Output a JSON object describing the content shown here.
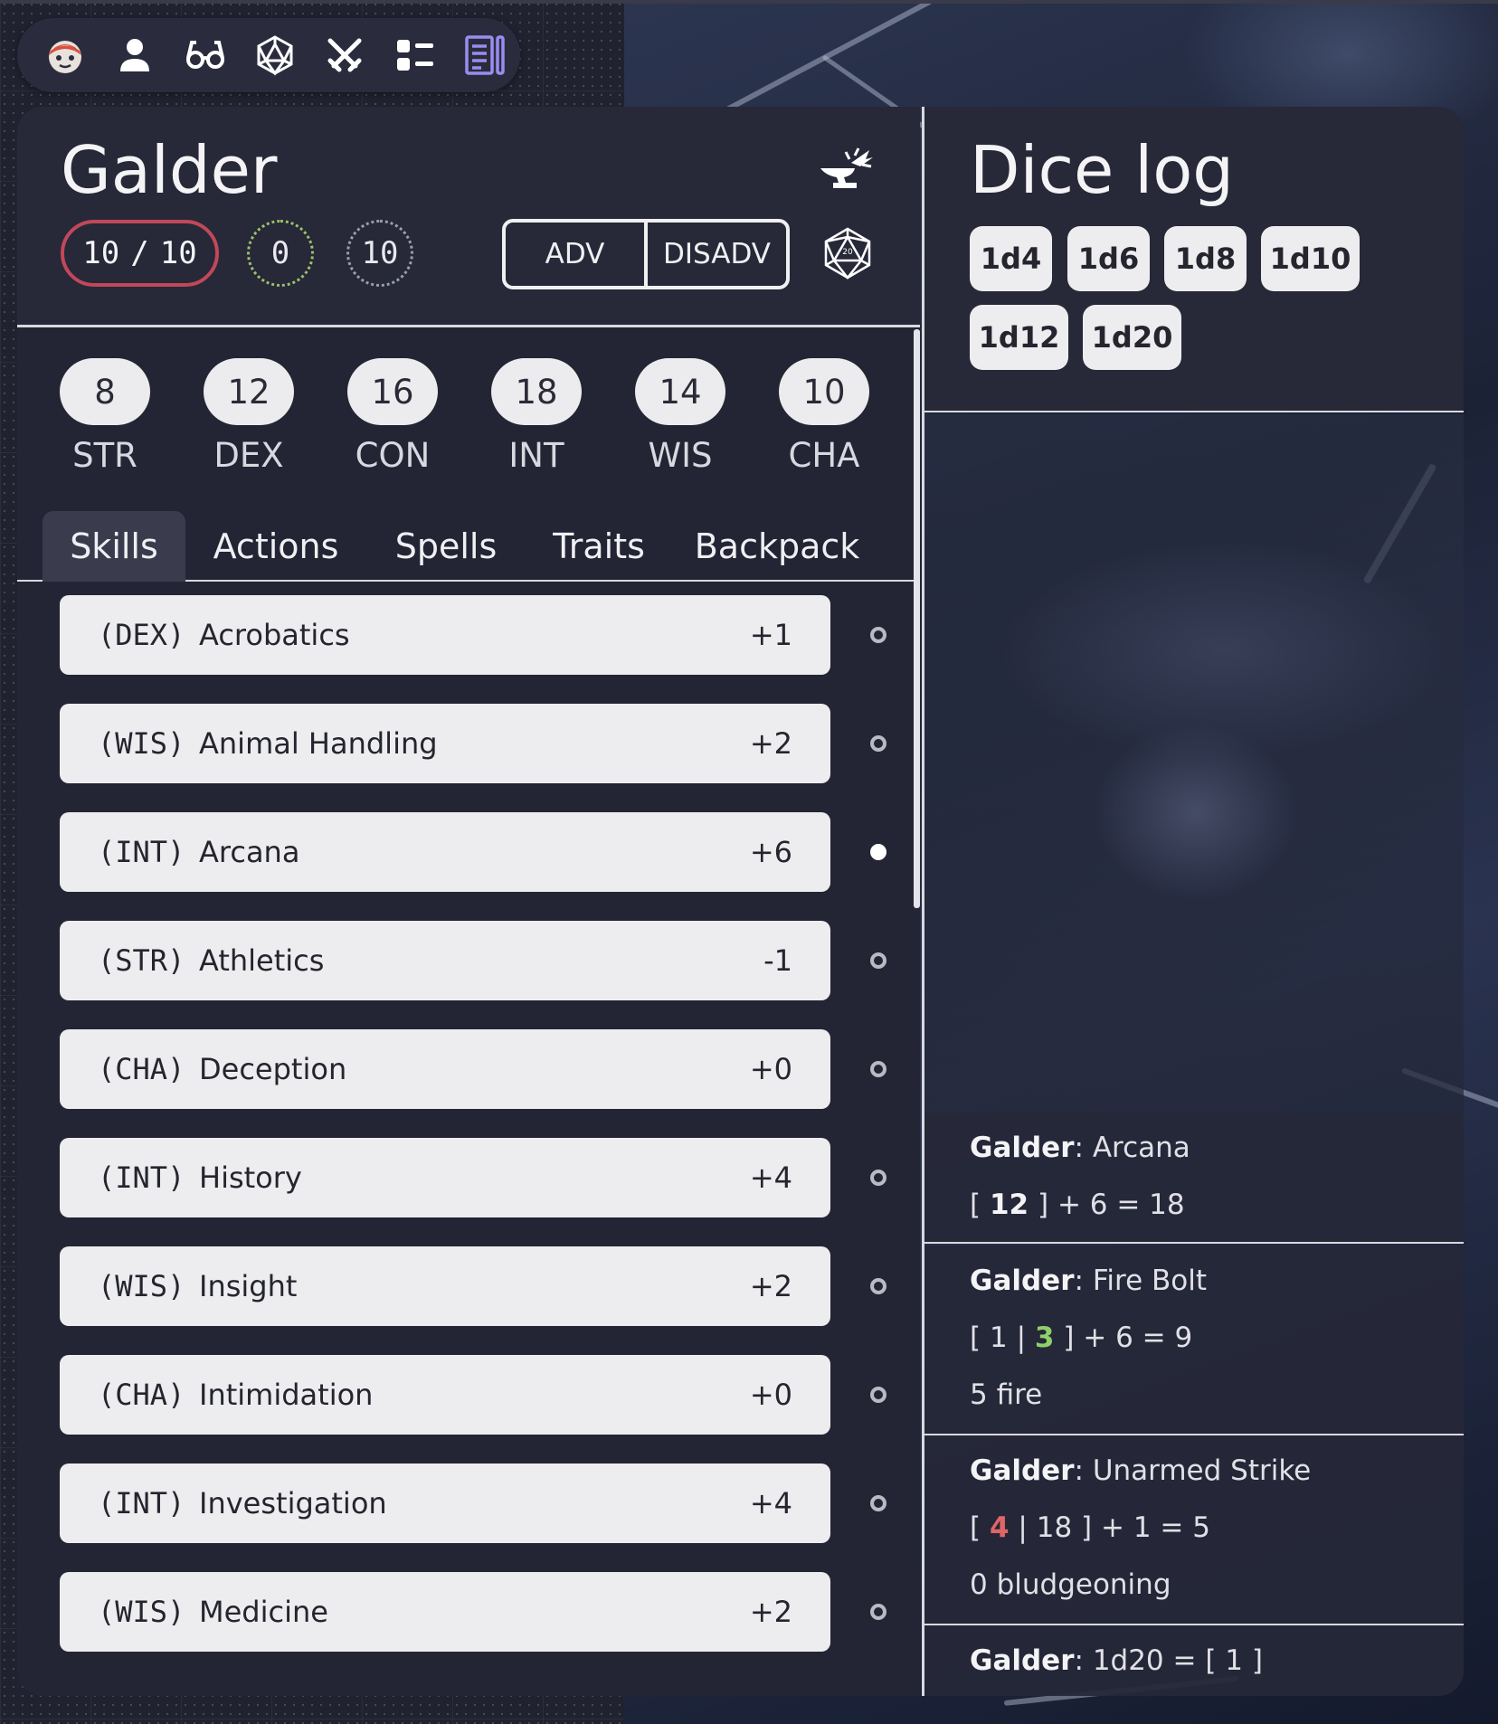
{
  "toolbar": {
    "items": [
      {
        "name": "app-logo-icon"
      },
      {
        "name": "character-icon"
      },
      {
        "name": "glasses-icon"
      },
      {
        "name": "dice-icon"
      },
      {
        "name": "crossed-swords-icon"
      },
      {
        "name": "list-icon"
      },
      {
        "name": "notes-icon",
        "active": true
      }
    ],
    "active_color": "#9b8cf0"
  },
  "character": {
    "name": "Galder",
    "hp_current": "10",
    "hp_sep": "/",
    "hp_max": "10",
    "temp_hp": "0",
    "ac": "10",
    "adv_label": "ADV",
    "disadv_label": "DISADV"
  },
  "abilities": [
    {
      "value": "8",
      "label": "STR"
    },
    {
      "value": "12",
      "label": "DEX"
    },
    {
      "value": "16",
      "label": "CON"
    },
    {
      "value": "18",
      "label": "INT"
    },
    {
      "value": "14",
      "label": "WIS"
    },
    {
      "value": "10",
      "label": "CHA"
    }
  ],
  "tabs": [
    "Skills",
    "Actions",
    "Spells",
    "Traits",
    "Backpack"
  ],
  "active_tab": "Skills",
  "skills": [
    {
      "ability": "(DEX)",
      "name": "Acrobatics",
      "mod": "+1",
      "proficient": false
    },
    {
      "ability": "(WIS)",
      "name": "Animal Handling",
      "mod": "+2",
      "proficient": false
    },
    {
      "ability": "(INT)",
      "name": "Arcana",
      "mod": "+6",
      "proficient": true
    },
    {
      "ability": "(STR)",
      "name": "Athletics",
      "mod": "-1",
      "proficient": false
    },
    {
      "ability": "(CHA)",
      "name": "Deception",
      "mod": "+0",
      "proficient": false
    },
    {
      "ability": "(INT)",
      "name": "History",
      "mod": "+4",
      "proficient": false
    },
    {
      "ability": "(WIS)",
      "name": "Insight",
      "mod": "+2",
      "proficient": false
    },
    {
      "ability": "(CHA)",
      "name": "Intimidation",
      "mod": "+0",
      "proficient": false
    },
    {
      "ability": "(INT)",
      "name": "Investigation",
      "mod": "+4",
      "proficient": false
    },
    {
      "ability": "(WIS)",
      "name": "Medicine",
      "mod": "+2",
      "proficient": false
    }
  ],
  "dice_log": {
    "title": "Dice log",
    "dice": [
      "1d4",
      "1d6",
      "1d8",
      "1d10",
      "1d12",
      "1d20"
    ],
    "entries": [
      {
        "who": "Galder",
        "what": "Arcana",
        "roll": {
          "open": "[",
          "dice": "12",
          "close": "]",
          "rest": "+ 6 = 18"
        }
      },
      {
        "who": "Galder",
        "what": "Fire Bolt",
        "roll": {
          "open": "[",
          "d1": "1",
          "sep": "|",
          "d2": "3",
          "close": "]",
          "rest": "+ 6 = 9"
        },
        "damage": "5 fire"
      },
      {
        "who": "Galder",
        "what": "Unarmed Strike",
        "roll": {
          "open": "[",
          "d1": "4",
          "sep": "|",
          "d2": "18",
          "close": "]",
          "rest": "+ 1 = 5"
        },
        "damage": "0 bludgeoning"
      },
      {
        "who": "Galder",
        "what": "1d20 = [ 1 ]"
      }
    ]
  }
}
